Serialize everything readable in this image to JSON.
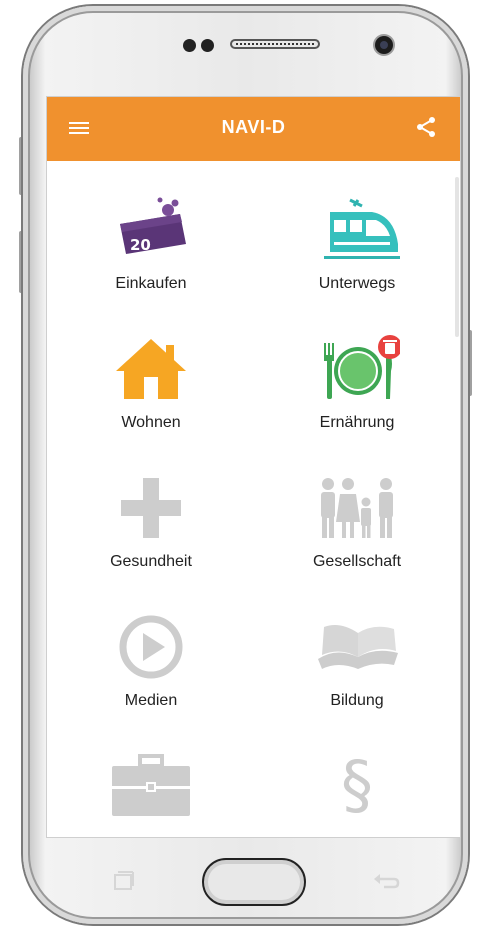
{
  "app": {
    "title": "NAVI-D",
    "accent_color": "#f0912e",
    "icons": {
      "menu": "hamburger-menu-icon",
      "share": "share-icon"
    }
  },
  "tiles": [
    {
      "label": "Einkaufen",
      "icon": "shopping-price-tag-icon",
      "badge_text": "20"
    },
    {
      "label": "Unterwegs",
      "icon": "train-icon"
    },
    {
      "label": "Wohnen",
      "icon": "house-icon"
    },
    {
      "label": "Ernährung",
      "icon": "plate-cutlery-icon",
      "badge_icon": "trash-badge-icon"
    },
    {
      "label": "Gesundheit",
      "icon": "medical-cross-icon"
    },
    {
      "label": "Gesellschaft",
      "icon": "family-icon"
    },
    {
      "label": "Medien",
      "icon": "play-circle-icon"
    },
    {
      "label": "Bildung",
      "icon": "open-book-icon"
    },
    {
      "label": "",
      "icon": "briefcase-icon"
    },
    {
      "label": "",
      "icon": "paragraph-law-icon",
      "glyph": "§"
    }
  ],
  "device_buttons": [
    "recents-icon",
    "home-button",
    "back-icon"
  ]
}
